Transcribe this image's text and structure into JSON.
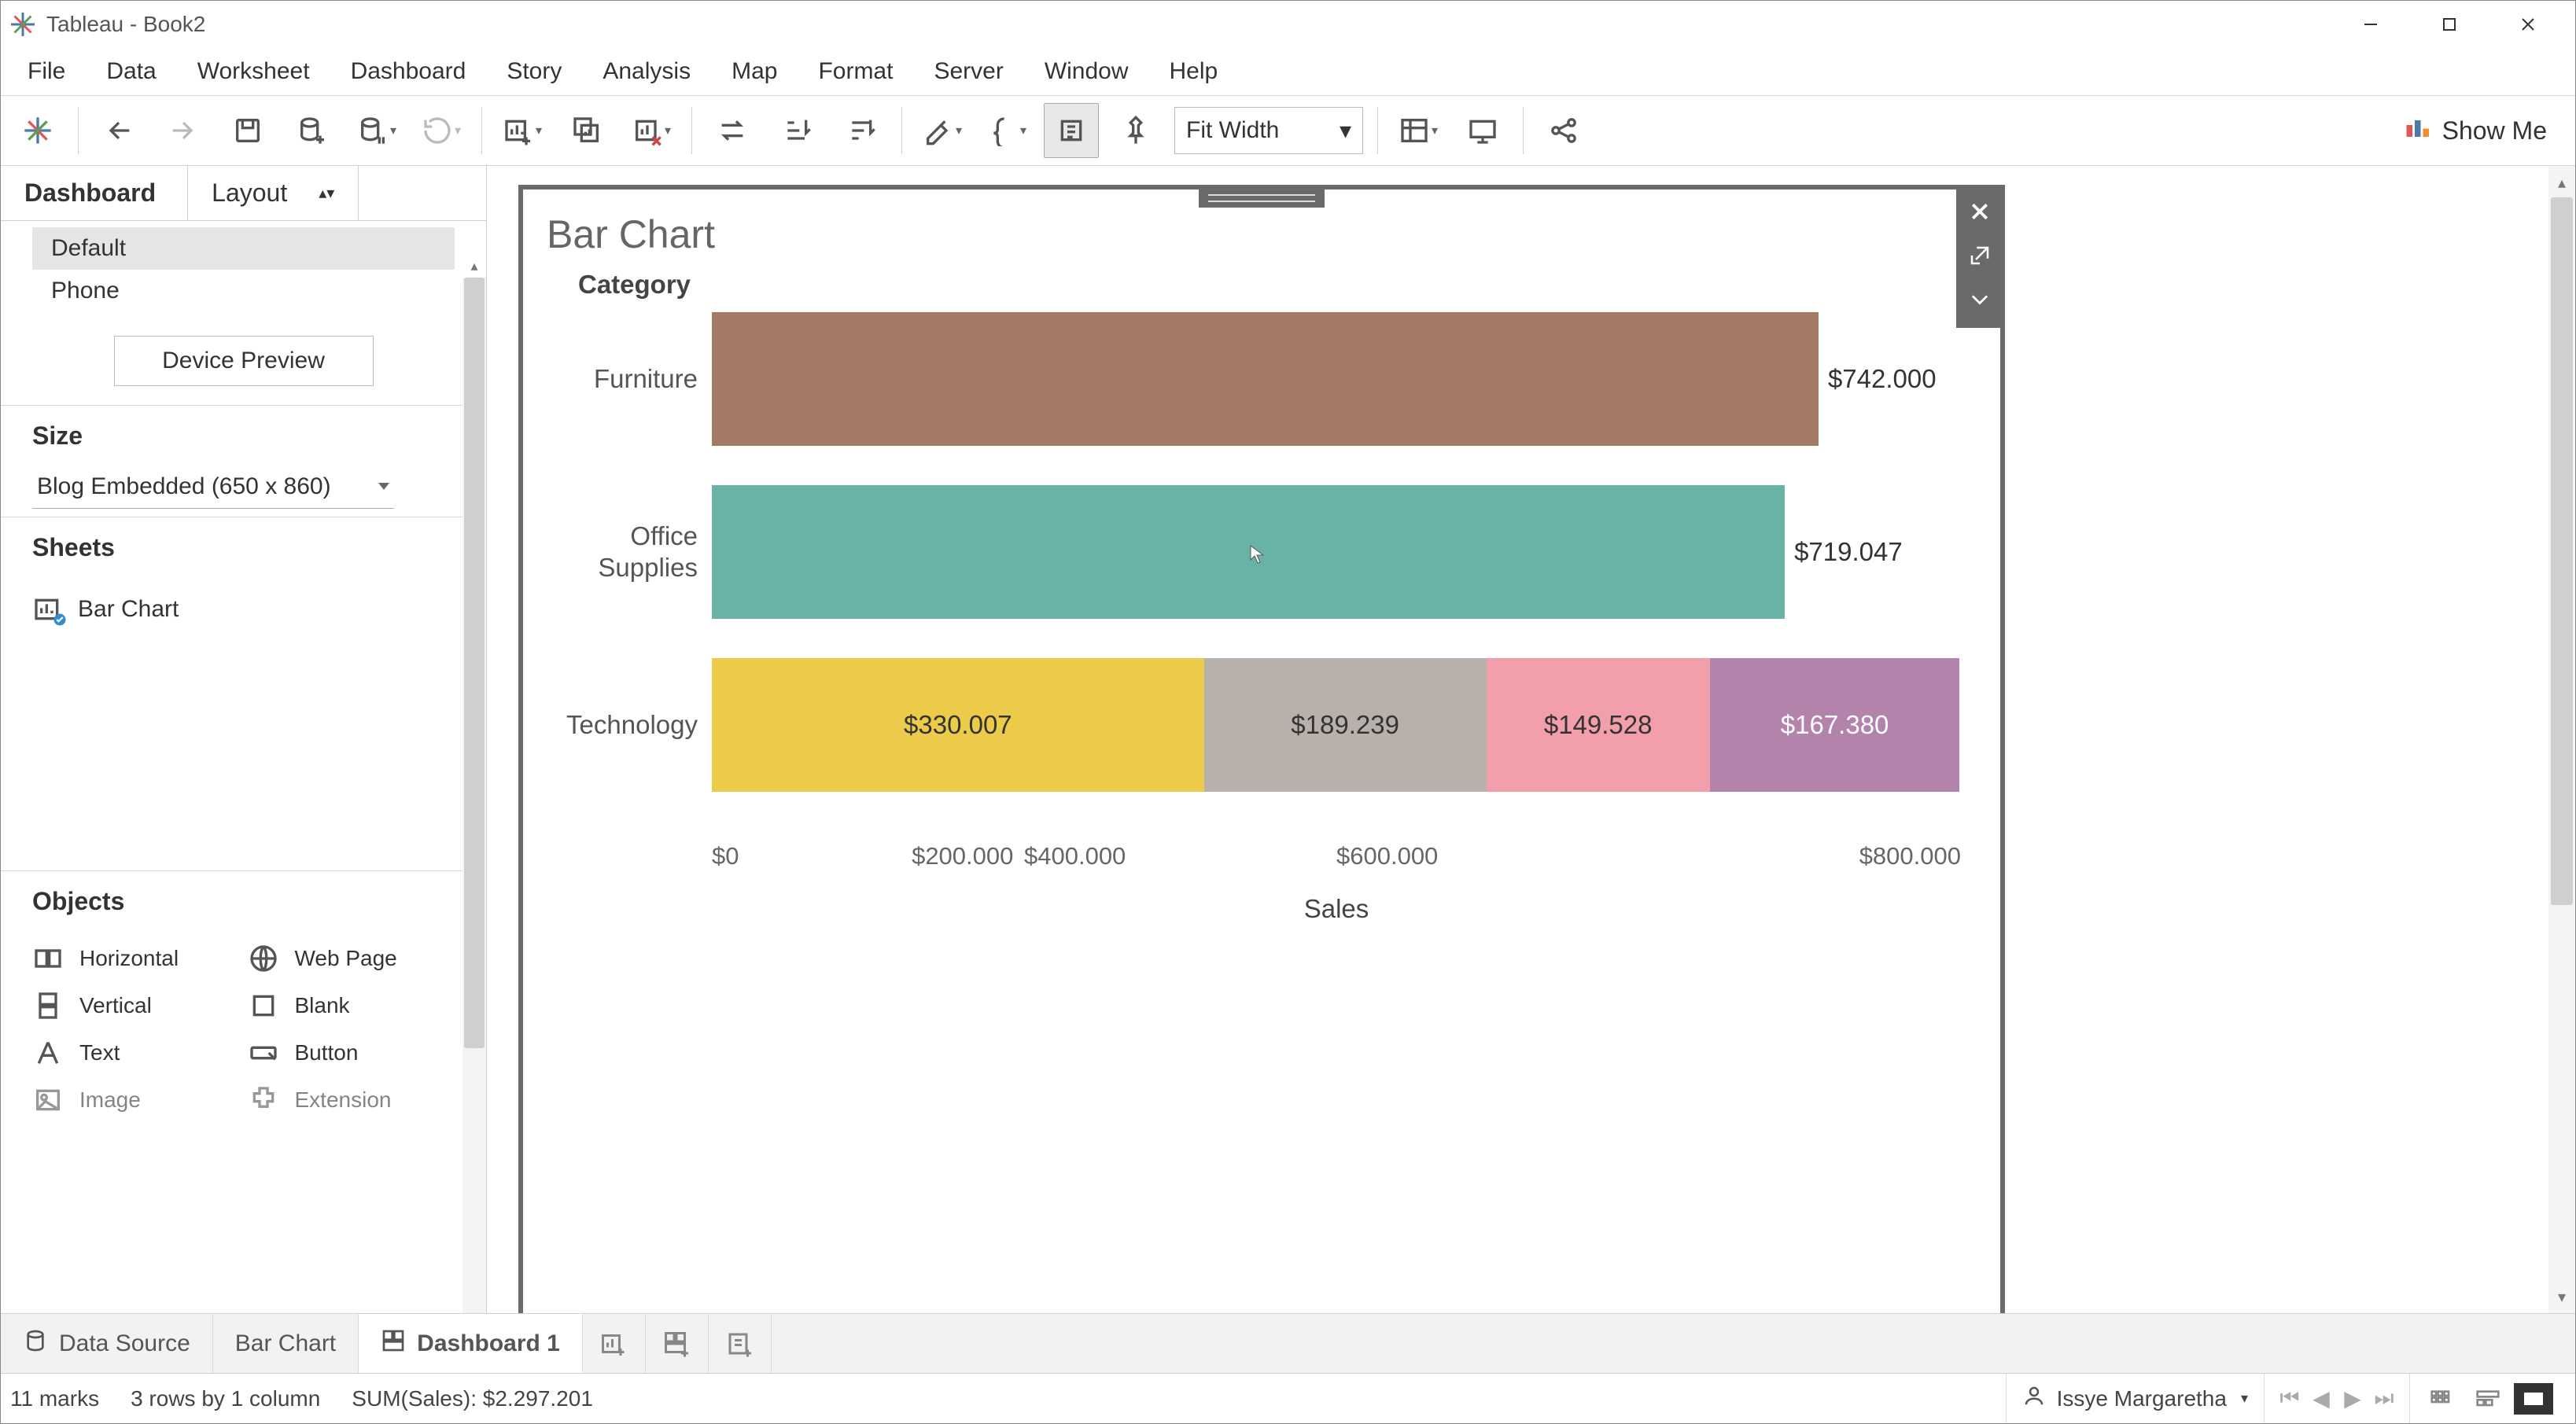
{
  "app": {
    "title": "Tableau - Book2"
  },
  "menu": [
    "File",
    "Data",
    "Worksheet",
    "Dashboard",
    "Story",
    "Analysis",
    "Map",
    "Format",
    "Server",
    "Window",
    "Help"
  ],
  "toolbar": {
    "fit": "Fit Width",
    "showme": "Show Me"
  },
  "leftpanel": {
    "tabs": {
      "primary": "Dashboard",
      "secondary": "Layout"
    },
    "devices": [
      "Default",
      "Phone"
    ],
    "device_preview": "Device Preview",
    "size_label": "Size",
    "size_value": "Blog Embedded (650 x 860)",
    "sheets_label": "Sheets",
    "sheets": [
      "Bar Chart"
    ],
    "objects_label": "Objects",
    "objects": [
      {
        "name": "Horizontal"
      },
      {
        "name": "Web Page"
      },
      {
        "name": "Vertical"
      },
      {
        "name": "Blank"
      },
      {
        "name": "Text"
      },
      {
        "name": "Button"
      },
      {
        "name": "Image"
      },
      {
        "name": "Extension"
      }
    ]
  },
  "dashboard": {
    "title": "Bar Chart",
    "y_header": "Category",
    "x_label": "Sales",
    "ticks": [
      "$0",
      "$200.000",
      "$400.000",
      "$600.000",
      "$800.000"
    ],
    "rows": [
      {
        "label": "Furniture",
        "total": "$742.000"
      },
      {
        "label": "Office Supplies",
        "total": "$719.047"
      },
      {
        "label": "Technology",
        "segments": [
          "$330.007",
          "$189.239",
          "$149.528",
          "$167.380"
        ]
      }
    ]
  },
  "tabs": {
    "data_source": "Data Source",
    "sheet1": "Bar Chart",
    "sheet2": "Dashboard 1"
  },
  "status": {
    "marks": "11 marks",
    "rows": "3 rows by 1 column",
    "sum": "SUM(Sales): $2.297.201",
    "user": "Issye Margaretha"
  },
  "chart_data": {
    "type": "bar",
    "title": "Bar Chart",
    "xlabel": "Sales",
    "ylabel": "Category",
    "xlim": [
      0,
      800000
    ],
    "ticks": [
      0,
      200000,
      400000,
      600000,
      800000
    ],
    "series": [
      {
        "category": "Furniture",
        "total": 742000,
        "segments": [
          742000
        ],
        "colors": [
          "#a47a64"
        ]
      },
      {
        "category": "Office Supplies",
        "total": 719047,
        "segments": [
          719047
        ],
        "colors": [
          "#68b2a6"
        ]
      },
      {
        "category": "Technology",
        "total": 836154,
        "segments": [
          330007,
          189239,
          149528,
          167380
        ],
        "colors": [
          "#ecca4a",
          "#b8b0aa",
          "#f29eab",
          "#b383ac"
        ]
      }
    ]
  }
}
